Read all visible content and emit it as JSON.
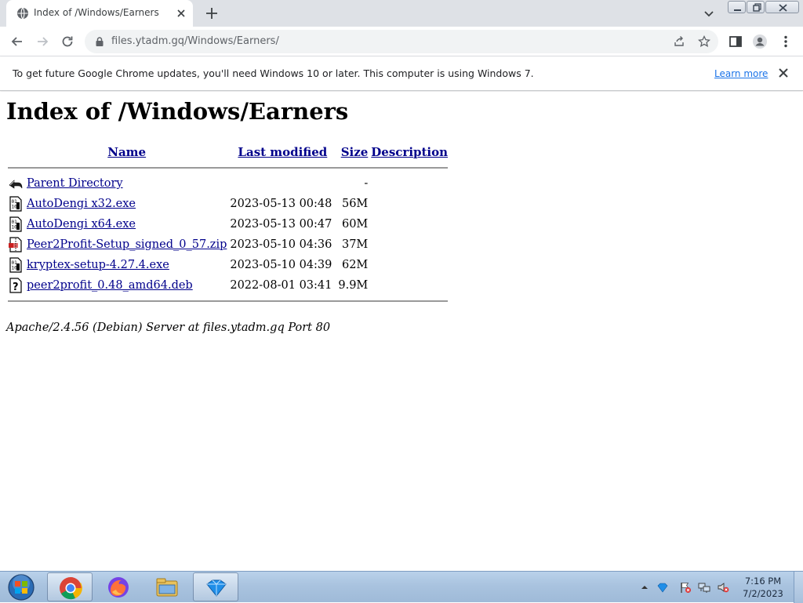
{
  "browser": {
    "tab": {
      "title": "Index of /Windows/Earners"
    },
    "url": {
      "host": "files.ytadm.gq",
      "path": "/Windows/Earners/"
    }
  },
  "infobar": {
    "message": "To get future Google Chrome updates, you'll need Windows 10 or later. This computer is using Windows 7.",
    "link_label": "Learn more"
  },
  "page": {
    "heading": "Index of /Windows/Earners",
    "columns": {
      "name": "Name",
      "modified": "Last modified",
      "size": "Size",
      "description": "Description"
    },
    "parent": {
      "label": "Parent Directory",
      "size": "-"
    },
    "files": [
      {
        "name": "AutoDengi x32.exe",
        "modified": "2023-05-13 00:48",
        "size": "56M",
        "icon": "binary-file-icon"
      },
      {
        "name": "AutoDengi x64.exe",
        "modified": "2023-05-13 00:47",
        "size": "60M",
        "icon": "binary-file-icon"
      },
      {
        "name": "Peer2Profit-Setup_signed_0_57.zip",
        "modified": "2023-05-10 04:36",
        "size": "37M",
        "icon": "compressed-file-icon"
      },
      {
        "name": "kryptex-setup-4.27.4.exe",
        "modified": "2023-05-10 04:39",
        "size": "62M",
        "icon": "binary-file-icon"
      },
      {
        "name": "peer2profit_0.48_amd64.deb",
        "modified": "2022-08-01 03:41",
        "size": "9.9M",
        "icon": "unknown-file-icon"
      }
    ],
    "address": "Apache/2.4.56 (Debian) Server at files.ytadm.gq Port 80"
  },
  "taskbar": {
    "apps": [
      "chrome-icon",
      "firefox-icon",
      "file-explorer-icon",
      "tray-app-icon"
    ],
    "clock": {
      "time": "7:16 PM",
      "date": "7/2/2023"
    }
  },
  "colors": {
    "link": "#00008b",
    "tabstrip": "#dee1e6",
    "taskbar": "#a9c3df"
  }
}
